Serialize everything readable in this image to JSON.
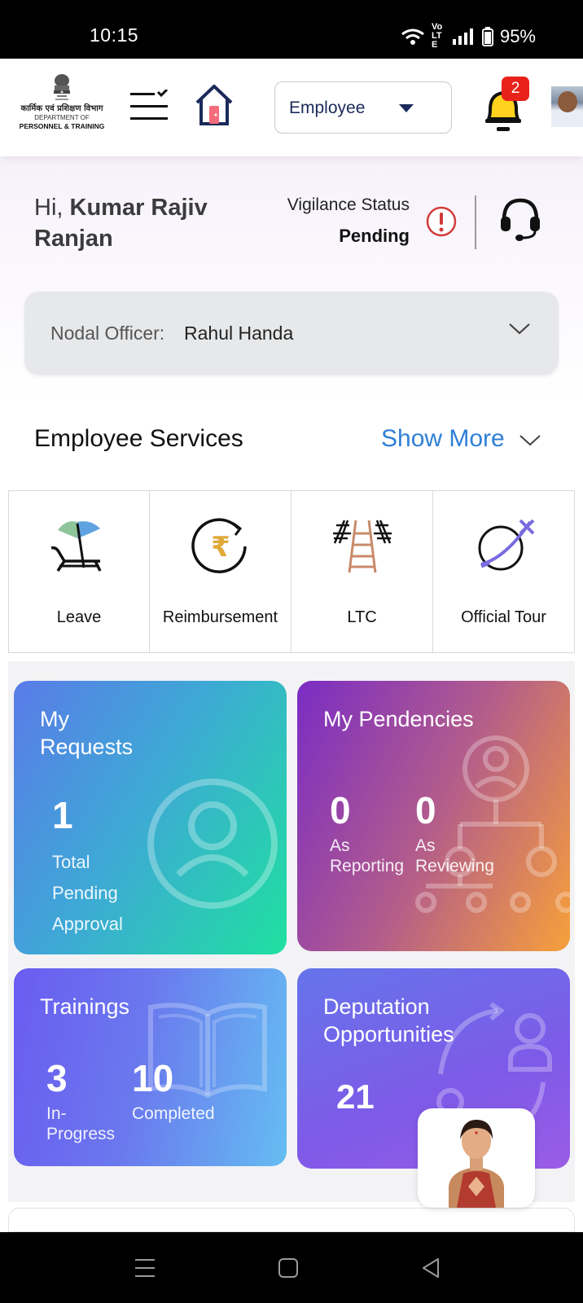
{
  "status_bar": {
    "time": "10:15",
    "battery": "95%",
    "network": "VoLTE"
  },
  "header": {
    "logo_hindi": "कार्मिक एवं प्रशिक्षण विभाग",
    "logo_dept_line1": "DEPARTMENT OF",
    "logo_dept_line2": "PERSONNEL & TRAINING",
    "role_select_value": "Employee",
    "notification_count": "2",
    "icons": [
      "menu-icon",
      "home-icon",
      "bell-icon",
      "user-avatar"
    ]
  },
  "greeting": {
    "prefix": "Hi, ",
    "name": "Kumar Rajiv Ranjan",
    "vigilance_label": "Vigilance Status",
    "vigilance_value": "Pending"
  },
  "nodal_officer": {
    "label": "Nodal Officer:",
    "name": "Rahul Handa"
  },
  "employee_services": {
    "title": "Employee Services",
    "show_more": "Show More",
    "items": [
      {
        "label": "Leave",
        "icon": "beach-umbrella-icon"
      },
      {
        "label": "Reimbursement",
        "icon": "rupee-refresh-icon"
      },
      {
        "label": "LTC",
        "icon": "railway-track-icon"
      },
      {
        "label": "Official Tour",
        "icon": "globe-plane-icon"
      }
    ]
  },
  "cards": {
    "my_requests": {
      "title_line1": "My",
      "title_line2": "Requests",
      "count": "1",
      "desc_line1": "Total",
      "desc_line2": "Pending",
      "desc_line3": "Approval"
    },
    "my_pendencies": {
      "title": "My Pendencies",
      "reporting_count": "0",
      "reporting_line1": "As",
      "reporting_line2": "Reporting",
      "reviewing_count": "0",
      "reviewing_line1": "As",
      "reviewing_line2": "Reviewing"
    },
    "trainings": {
      "title": "Trainings",
      "in_progress_count": "3",
      "in_progress_line1": "In-",
      "in_progress_line2": "Progress",
      "completed_count": "10",
      "completed_label": "Completed"
    },
    "deputation": {
      "title_line1": "Deputation",
      "title_line2": "Opportunities",
      "count": "21"
    }
  },
  "colors": {
    "accent_blue": "#2f7fd6",
    "badge_red": "#e8221b",
    "alert_red": "#d23a3a"
  }
}
